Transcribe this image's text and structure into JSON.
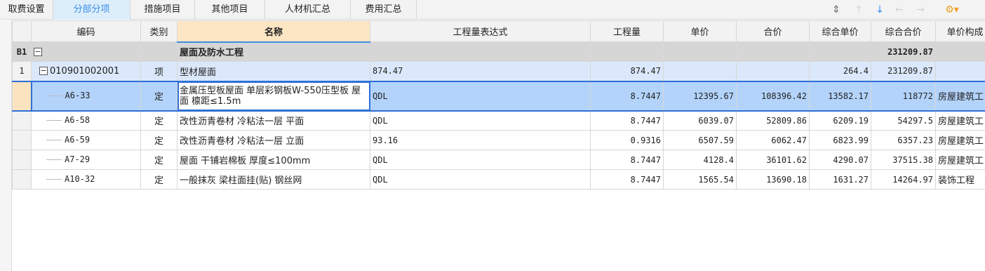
{
  "tabs": [
    {
      "label": "取费设置",
      "active": false
    },
    {
      "label": "分部分项",
      "active": true
    },
    {
      "label": "措施项目",
      "active": false
    },
    {
      "label": "其他项目",
      "active": false
    },
    {
      "label": "人材机汇总",
      "active": false
    },
    {
      "label": "费用汇总",
      "active": false
    }
  ],
  "toolbar": {
    "updown_icon": "⇕",
    "up_icon": "↑",
    "down_icon": "↓",
    "left_icon": "←",
    "right_icon": "→",
    "settings_icon": "⚙▾"
  },
  "columns": [
    "编码",
    "类别",
    "名称",
    "工程量表达式",
    "工程量",
    "单价",
    "合价",
    "综合单价",
    "综合合价",
    "单价构成"
  ],
  "rows": [
    {
      "rownum": "B1",
      "code": "",
      "type": "",
      "name": "屋面及防水工程",
      "expr": "",
      "qty": "",
      "unit_price": "",
      "total": "",
      "comp_unit": "",
      "comp_total": "231209.87",
      "composition": ""
    },
    {
      "rownum": "1",
      "code": "010901002001",
      "type": "项",
      "name": "型材屋面",
      "expr": "874.47",
      "qty": "874.47",
      "unit_price": "",
      "total": "",
      "comp_unit": "264.4",
      "comp_total": "231209.87",
      "composition": ""
    },
    {
      "rownum": "",
      "code": "A6-33",
      "type": "定",
      "name": "金属压型板屋面 单层彩钢板W-550压型板 屋面 檩距≤1.5m",
      "expr": "QDL",
      "qty": "8.7447",
      "unit_price": "12395.67",
      "total": "108396.42",
      "comp_unit": "13582.17",
      "comp_total": "118772",
      "composition": "房屋建筑工"
    },
    {
      "rownum": "",
      "code": "A6-58",
      "type": "定",
      "name": "改性沥青卷材 冷粘法一层 平面",
      "expr": "QDL",
      "qty": "8.7447",
      "unit_price": "6039.07",
      "total": "52809.86",
      "comp_unit": "6209.19",
      "comp_total": "54297.5",
      "composition": "房屋建筑工"
    },
    {
      "rownum": "",
      "code": "A6-59",
      "type": "定",
      "name": "改性沥青卷材 冷粘法一层 立面",
      "expr": "93.16",
      "qty": "0.9316",
      "unit_price": "6507.59",
      "total": "6062.47",
      "comp_unit": "6823.99",
      "comp_total": "6357.23",
      "composition": "房屋建筑工"
    },
    {
      "rownum": "",
      "code": "A7-29",
      "type": "定",
      "name": "屋面 干铺岩棉板 厚度≤100mm",
      "expr": "QDL",
      "qty": "8.7447",
      "unit_price": "4128.4",
      "total": "36101.62",
      "comp_unit": "4290.07",
      "comp_total": "37515.38",
      "composition": "房屋建筑工"
    },
    {
      "rownum": "",
      "code": "A10-32",
      "type": "定",
      "name": "一般抹灰 梁柱面挂(贴) 钢丝网",
      "expr": "QDL",
      "qty": "8.7447",
      "unit_price": "1565.54",
      "total": "13690.18",
      "comp_unit": "1631.27",
      "comp_total": "14264.97",
      "composition": "装饰工程"
    }
  ],
  "colors": {
    "accent": "#3a8ee6",
    "selection": "#b3d3fb",
    "item_row": "#dbe8fb",
    "section_row": "#d6d6d6"
  }
}
